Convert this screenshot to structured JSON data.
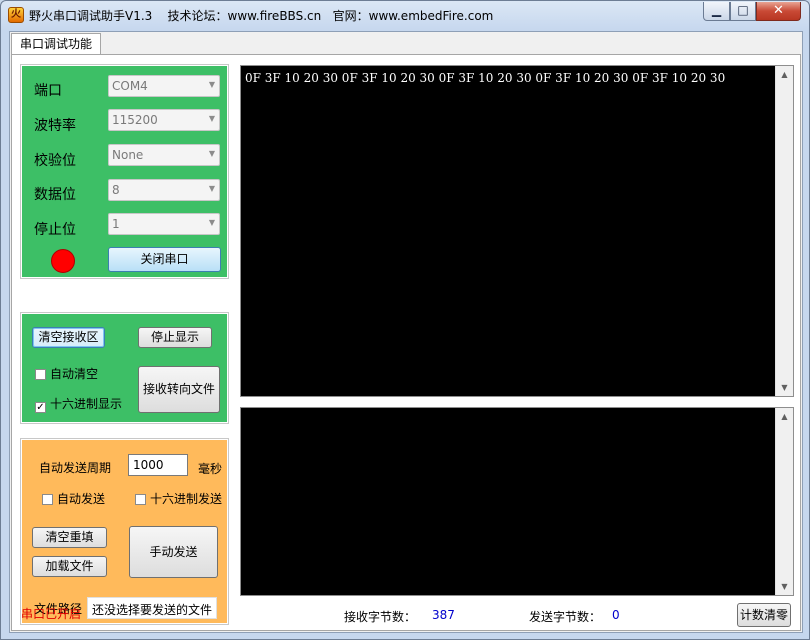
{
  "window": {
    "title": "野火串口调试助手V1.3    技术论坛：www.fireBBS.cn   官网：www.embedFire.com",
    "minimize_glyph": "▁",
    "maximize_glyph": "□",
    "close_glyph": "✕",
    "app_icon": "fire-icon"
  },
  "tab": {
    "label": "串口调试功能"
  },
  "serial_settings": {
    "port_label": "端口",
    "port_value": "COM4",
    "baud_label": "波特率",
    "baud_value": "115200",
    "parity_label": "校验位",
    "parity_value": "None",
    "databits_label": "数据位",
    "databits_value": "8",
    "stopbits_label": "停止位",
    "stopbits_value": "1",
    "status_led_color": "#ff0000",
    "close_port_button": "关闭串口",
    "combo_arrow": "▼"
  },
  "receive_controls": {
    "clear_button": "清空接收区",
    "stop_display_button": "停止显示",
    "auto_clear_label": "自动清空",
    "auto_clear_checked": false,
    "hex_display_label": "十六进制显示",
    "hex_display_checked": true,
    "check_mark": "✓",
    "redirect_button": "接收转向文件"
  },
  "send_controls": {
    "period_label": "自动发送周期",
    "period_value": "1000",
    "period_unit": "毫秒",
    "auto_send_label": "自动发送",
    "auto_send_checked": false,
    "hex_send_label": "十六进制发送",
    "hex_send_checked": false,
    "clear_refill_button": "清空重填",
    "load_file_button": "加载文件",
    "manual_send_button": "手动发送",
    "file_path_label": "文件路径",
    "file_path_value": "还没选择要发送的文件"
  },
  "receive_area": {
    "text": "0F 3F 10 20 30 0F 3F 10 20 30 0F 3F 10 20 30 0F 3F 10 20 30 0F 3F 10 20 30"
  },
  "send_area": {
    "text": ""
  },
  "scrollbar": {
    "up": "▲",
    "down": "▼"
  },
  "status_bar": {
    "port_status": "串口已开启",
    "port_status_color": "#e00000",
    "rx_label": "接收字节数：",
    "rx_count": "387",
    "tx_label": "发送字节数：",
    "tx_count": "0",
    "count_color": "#0000cc",
    "reset_count_button": "计数清零"
  }
}
